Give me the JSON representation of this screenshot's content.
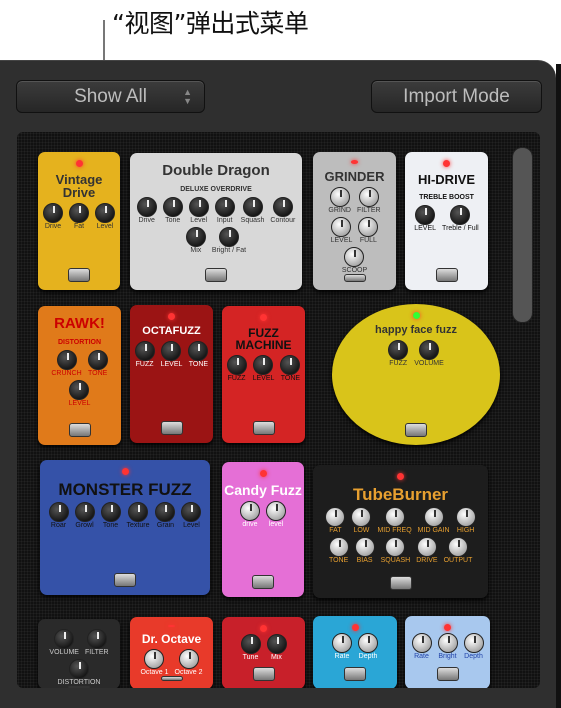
{
  "callout": "“视图”弹出式菜单",
  "toolbar": {
    "view_popup": "Show All",
    "import_mode": "Import Mode"
  },
  "pedals": [
    {
      "name": "Vintage Drive",
      "knobs": [
        "Drive",
        "Fat",
        "Level"
      ],
      "color": "#e5b21e",
      "fg": "#333"
    },
    {
      "name": "Double Dragon",
      "sub": "DELUXE OVERDRIVE",
      "knobs": [
        "Drive",
        "Tone",
        "Level",
        "Input",
        "Squash",
        "Contour",
        "Mix",
        "Bright / Fat"
      ],
      "color": "#d8d8d8",
      "fg": "#333"
    },
    {
      "name": "GRINDER",
      "knobs": [
        "GRIND",
        "FILTER",
        "LEVEL",
        "FULL",
        "SCOOP"
      ],
      "color": "#bdbdbd",
      "fg": "#333",
      "silver": true
    },
    {
      "name": "HI-DRIVE",
      "sub": "TREBLE BOOST",
      "knobs": [
        "LEVEL",
        "Treble / Full"
      ],
      "color": "#eef0f4",
      "fg": "#111"
    },
    {
      "name": "RAWK!",
      "sub": "DISTORTION",
      "knobs": [
        "CRUNCH",
        "TONE",
        "LEVEL"
      ],
      "color": "#e07a1a",
      "fg": "#c00"
    },
    {
      "name": "OCTAFUZZ",
      "knobs": [
        "FUZZ",
        "LEVEL",
        "TONE"
      ],
      "color": "#9b1414",
      "fg": "#fff"
    },
    {
      "name": "FUZZ MACHINE",
      "knobs": [
        "FUZZ",
        "LEVEL",
        "TONE"
      ],
      "color": "#d42424",
      "fg": "#111"
    },
    {
      "name": "happy face fuzz",
      "knobs": [
        "FUZZ",
        "VOLUME"
      ],
      "color": "#d9c41a",
      "fg": "#333"
    },
    {
      "name": "MONSTER FUZZ",
      "knobs": [
        "Roar",
        "Growl",
        "Tone",
        "Texture",
        "Grain",
        "Level"
      ],
      "color": "#3552a8",
      "fg": "#111"
    },
    {
      "name": "Candy Fuzz",
      "knobs": [
        "drive",
        "level"
      ],
      "color": "#e56fd6",
      "fg": "#fff",
      "silver": true
    },
    {
      "name": "TubeBurner",
      "knobs": [
        "FAT",
        "LOW",
        "MID FREQ",
        "MID GAIN",
        "HIGH",
        "TONE",
        "BIAS",
        "SQUASH",
        "DRIVE",
        "OUTPUT"
      ],
      "color": "#1d1d1d",
      "fg": "#e8a030",
      "silver": true
    },
    {
      "name": "",
      "knobs": [
        "VOLUME",
        "FILTER",
        "DISTORTION"
      ],
      "color": "#2a2a2a",
      "fg": "#ccc"
    },
    {
      "name": "Dr. Octave",
      "knobs": [
        "Octave 1",
        "Octave 2"
      ],
      "color": "#e83a2a",
      "fg": "#fff",
      "silver": true
    },
    {
      "name": "",
      "knobs": [
        "Tune",
        "Mix"
      ],
      "color": "#c8202a",
      "fg": "#fff"
    },
    {
      "name": "",
      "knobs": [
        "Rate",
        "Depth"
      ],
      "color": "#2aa6d6",
      "fg": "#fff",
      "silver": true
    },
    {
      "name": "",
      "knobs": [
        "Rate",
        "Bright",
        "Depth"
      ],
      "color": "#a8c8ee",
      "fg": "#2244aa",
      "silver": true
    }
  ]
}
